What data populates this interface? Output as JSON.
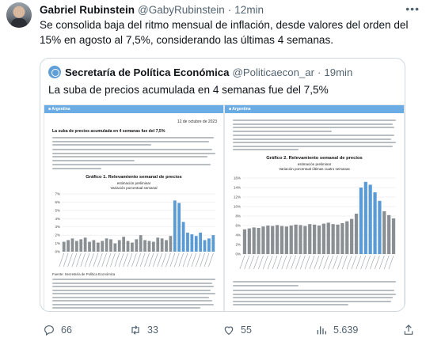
{
  "tweet": {
    "author_name": "Gabriel Rubinstein",
    "author_handle": "@GabyRubinstein",
    "separator": "·",
    "time": "12min",
    "more_icon": "more-icon",
    "text": "Se consolida baja del ritmo mensual de inflación, desde valores del orden del 15% en agosto al 7,5%, considerando las últimas 4 semanas."
  },
  "quote": {
    "author_name": "Secretaría de Política Económica",
    "author_handle": "@Politicaecon_ar",
    "separator": "·",
    "time": "19min",
    "text": "La suba de precios acumulada en 4 semanas fue del 7,5%",
    "documents": {
      "left": {
        "date": "12 de octubre de 2023",
        "heading": "La suba de precios acumulada en 4 semanas fue del 7,5%",
        "figure_title": "Gráfico 1. Relevamiento semanal de precios",
        "figure_sub1": "estimación preliminar",
        "figure_sub2": "Variación porcentual semanal",
        "source": "Fuente: Secretaría de Política Económica"
      },
      "right": {
        "figure_title": "Gráfico 2. Relevamiento semanal de precios",
        "figure_sub1": "estimación preliminar",
        "figure_sub2": "Variación porcentual últimas cuatro semanas"
      }
    }
  },
  "chart_data": [
    {
      "type": "bar",
      "title": "Gráfico 1. Relevamiento semanal de precios",
      "subtitle": "estimación preliminar — Variación porcentual semanal",
      "ylim": [
        0,
        7
      ],
      "y_ticks": [
        0,
        1,
        2,
        3,
        4,
        5,
        6,
        7
      ],
      "values": [
        1.2,
        1.4,
        1.6,
        1.3,
        1.5,
        1.7,
        1.2,
        1.4,
        1.1,
        1.3,
        1.6,
        1.5,
        1.0,
        1.4,
        1.8,
        1.3,
        1.1,
        1.5,
        2.0,
        1.4,
        1.3,
        1.2,
        1.7,
        1.6,
        1.4,
        1.9,
        6.2,
        5.9,
        3.6,
        2.3,
        2.1,
        1.9,
        2.3,
        1.4,
        1.6,
        2.0
      ],
      "highlight_from_index": 26,
      "colors": {
        "normal": "#8a8f94",
        "highlight": "#5b9bd5"
      },
      "grid": true
    },
    {
      "type": "area",
      "title": "Gráfico 2. Relevamiento semanal de precios",
      "subtitle": "estimación preliminar — Variación porcentual últimas cuatro semanas",
      "ylim": [
        0,
        16
      ],
      "y_ticks": [
        "0%",
        "2%",
        "4%",
        "6%",
        "8%",
        "10%",
        "12%",
        "14%",
        "16%"
      ],
      "values": [
        5.2,
        5.4,
        5.6,
        5.5,
        5.8,
        6.0,
        5.9,
        6.1,
        5.9,
        5.8,
        6.0,
        6.2,
        6.1,
        5.9,
        6.3,
        6.2,
        6.0,
        6.4,
        6.6,
        6.3,
        6.2,
        6.5,
        6.9,
        7.4,
        8.5,
        14.0,
        15.2,
        14.6,
        13.0,
        11.2,
        9.0,
        8.2,
        7.5
      ],
      "colors": {
        "fill": "#8a8f94",
        "highlight": "#5b9bd5"
      },
      "grid": true
    }
  ],
  "actions": {
    "reply_count": "66",
    "retweet_count": "33",
    "like_count": "55",
    "views_count": "5.639",
    "icons": [
      "reply-icon",
      "retweet-icon",
      "like-icon",
      "views-icon",
      "share-icon"
    ]
  }
}
